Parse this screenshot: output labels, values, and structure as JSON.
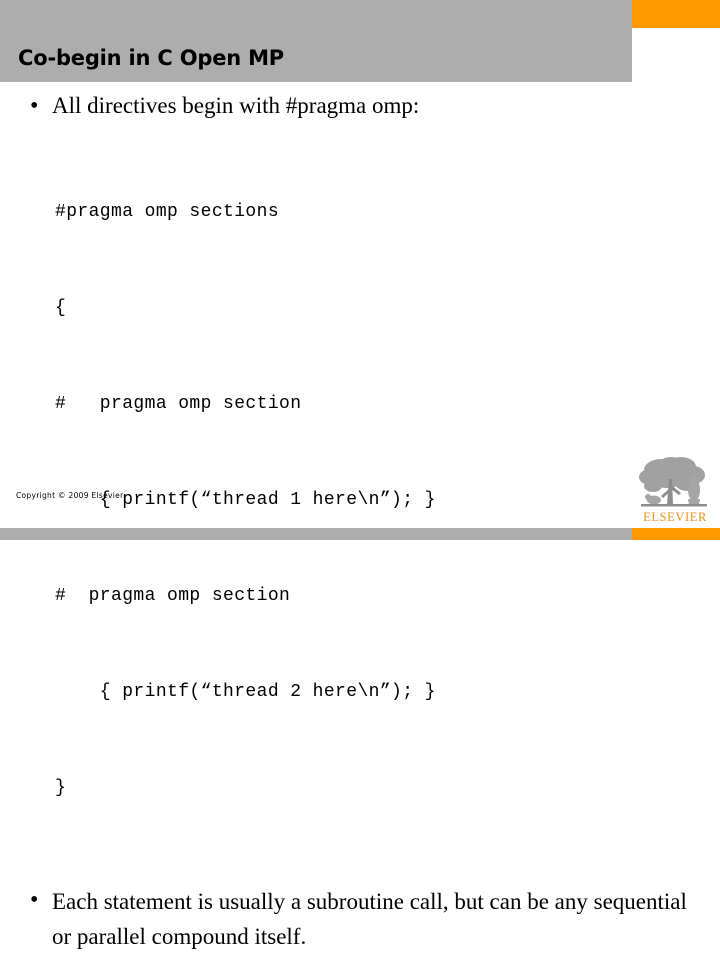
{
  "slide": {
    "title": "Co-begin in C Open MP",
    "bullets": [
      {
        "marker": "•",
        "text": "All directives begin with #pragma omp:"
      },
      {
        "marker": "•",
        "text": "Each statement is usually a subroutine call, but can be any sequential or parallel compound itself."
      }
    ],
    "code_lines": [
      "#pragma omp sections",
      "{",
      "#   pragma omp section",
      "    { printf(“thread 1 here\\n”); }",
      "#  pragma omp section",
      "    { printf(“thread 2 here\\n”); }",
      "}"
    ],
    "copyright": "Copyright © 2009 Elsevier",
    "logo": {
      "wordmark": "ELSEVIER",
      "icon": "elsevier-tree-logo"
    },
    "colors": {
      "header_gray": "#adadad",
      "accent_orange": "#ff9900",
      "logo_gold": "#e8921f",
      "text": "#000000",
      "background": "#ffffff"
    }
  }
}
